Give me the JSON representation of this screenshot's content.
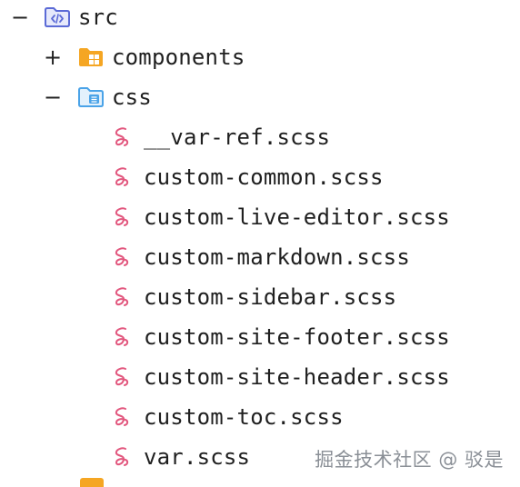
{
  "tree": {
    "root": {
      "toggle": "−",
      "label": "src",
      "icon": "folder-src-icon",
      "expanded": true
    },
    "children": [
      {
        "toggle": "+",
        "label": "components",
        "icon": "folder-components-icon",
        "expanded": false
      },
      {
        "toggle": "−",
        "label": "css",
        "icon": "folder-css-icon",
        "expanded": true,
        "files": [
          {
            "label": "__var-ref.scss",
            "icon": "sass-icon"
          },
          {
            "label": "custom-common.scss",
            "icon": "sass-icon"
          },
          {
            "label": "custom-live-editor.scss",
            "icon": "sass-icon"
          },
          {
            "label": "custom-markdown.scss",
            "icon": "sass-icon"
          },
          {
            "label": "custom-sidebar.scss",
            "icon": "sass-icon"
          },
          {
            "label": "custom-site-footer.scss",
            "icon": "sass-icon"
          },
          {
            "label": "custom-site-header.scss",
            "icon": "sass-icon"
          },
          {
            "label": "custom-toc.scss",
            "icon": "sass-icon"
          },
          {
            "label": "var.scss",
            "icon": "sass-icon"
          }
        ]
      }
    ]
  },
  "watermark": {
    "text": "掘金技术社区 @ 驳是"
  },
  "colors": {
    "folder_src": "#5b6ad6",
    "folder_components": "#f5a623",
    "folder_css": "#4aa3e8",
    "sass": "#e2577e",
    "text": "#1f1f1f",
    "watermark": "#8a8f96"
  }
}
